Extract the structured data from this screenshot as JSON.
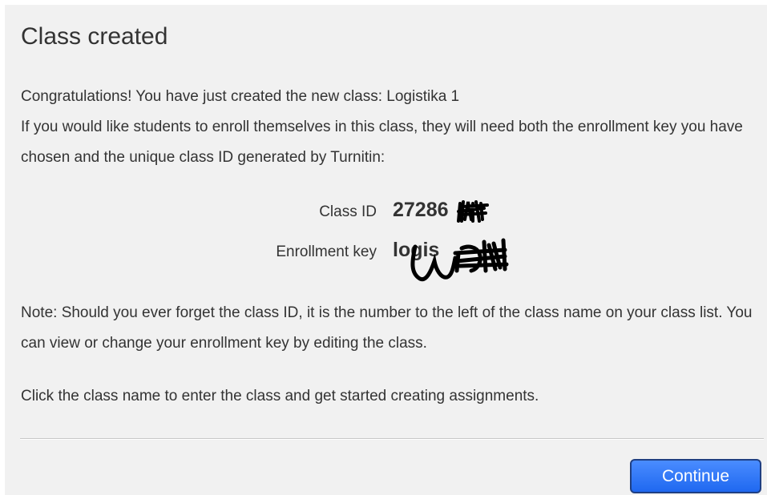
{
  "dialog": {
    "title": "Class created",
    "intro_line1": "Congratulations! You have just created the new class: Logistika 1",
    "intro_line2": "If you would like students to enroll themselves in this class, they will need both the enrollment key you have chosen and the unique class ID generated by Turnitin:",
    "class_id_label": "Class ID",
    "class_id_value": "27286",
    "enrollment_key_label": "Enrollment key",
    "enrollment_key_value": "logis",
    "note": "Note: Should you ever forget the class ID, it is the number to the left of the class name on your class list. You can view or change your enrollment key by editing the class.",
    "instruction": "Click the class name to enter the class and get started creating assignments.",
    "continue_label": "Continue"
  },
  "colors": {
    "dialog_background": "#f1f1f1",
    "text": "#333333",
    "button_blue": "#2a74f5",
    "button_border": "#1f3f82",
    "redaction": "#000000"
  }
}
